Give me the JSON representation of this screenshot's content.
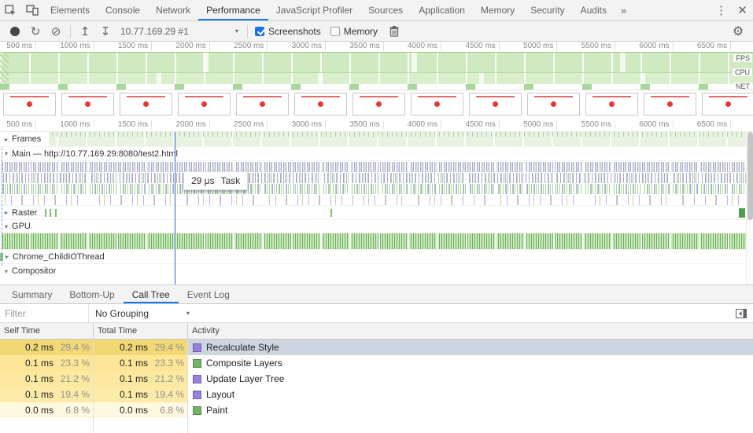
{
  "tabbar": {
    "tabs": [
      "Elements",
      "Console",
      "Network",
      "Performance",
      "JavaScript Profiler",
      "Sources",
      "Application",
      "Memory",
      "Security",
      "Audits"
    ],
    "active_tab": "Performance",
    "overflow_icon": "»",
    "menu_icon": "⋮",
    "close_icon": "✕"
  },
  "controls": {
    "target": "10.77.169.29 #1",
    "screenshots": {
      "label": "Screenshots",
      "checked": true
    },
    "memory": {
      "label": "Memory",
      "checked": false
    }
  },
  "ruler_ticks": [
    "500 ms",
    "1000 ms",
    "1500 ms",
    "2000 ms",
    "2500 ms",
    "3000 ms",
    "3500 ms",
    "4000 ms",
    "4500 ms",
    "5000 ms",
    "5500 ms",
    "6000 ms",
    "6500 ms"
  ],
  "overview": {
    "row_labels": [
      "FPS",
      "CPU",
      "NET"
    ]
  },
  "filmstrip": {
    "count": 13
  },
  "tracks": {
    "frames_label": "Frames",
    "main_label": "Main — http://10.77.169.29:8080/test2.html",
    "raster_label": "Raster",
    "gpu_label": "GPU",
    "io_label": "Chrome_ChildIOThread",
    "compositor_label": "Compositor",
    "tooltip": {
      "duration": "29 μs",
      "title": "Task"
    }
  },
  "bottom_tabs": {
    "tabs": [
      "Summary",
      "Bottom-Up",
      "Call Tree",
      "Event Log"
    ],
    "active_tab": "Call Tree"
  },
  "filter": {
    "placeholder": "Filter",
    "grouping": "No Grouping"
  },
  "call_tree": {
    "columns": [
      "Self Time",
      "Total Time",
      "Activity"
    ],
    "rows": [
      {
        "self_time": "0.2 ms",
        "self_pct": "29.4 %",
        "total_time": "0.2 ms",
        "total_pct": "29.4 %",
        "pct": 29.4,
        "activity": "Recalculate Style",
        "color": "#9a7ee0",
        "selected": true
      },
      {
        "self_time": "0.1 ms",
        "self_pct": "23.3 %",
        "total_time": "0.1 ms",
        "total_pct": "23.3 %",
        "pct": 23.3,
        "activity": "Composite Layers",
        "color": "#74b266",
        "selected": false
      },
      {
        "self_time": "0.1 ms",
        "self_pct": "21.2 %",
        "total_time": "0.1 ms",
        "total_pct": "21.2 %",
        "pct": 21.2,
        "activity": "Update Layer Tree",
        "color": "#9a7ee0",
        "selected": false
      },
      {
        "self_time": "0.1 ms",
        "self_pct": "19.4 %",
        "total_time": "0.1 ms",
        "total_pct": "19.4 %",
        "pct": 19.4,
        "activity": "Layout",
        "color": "#9a7ee0",
        "selected": false
      },
      {
        "self_time": "0.0 ms",
        "self_pct": "6.8 %",
        "total_time": "0.0 ms",
        "total_pct": "6.8 %",
        "pct": 6.8,
        "activity": "Paint",
        "color": "#74b266",
        "selected": false
      }
    ]
  },
  "icons": {
    "collapsed": "▸",
    "expanded": "▾",
    "caret": "▾",
    "reload": "↻",
    "clear": "⊘",
    "load": "↥",
    "save": "↧",
    "gear": "⚙"
  },
  "colors": {
    "accent": "#1a73e8",
    "heat": "#ffd650",
    "purple": "#9a7ee0",
    "green": "#74b266",
    "selection": "#cdd6e0"
  }
}
